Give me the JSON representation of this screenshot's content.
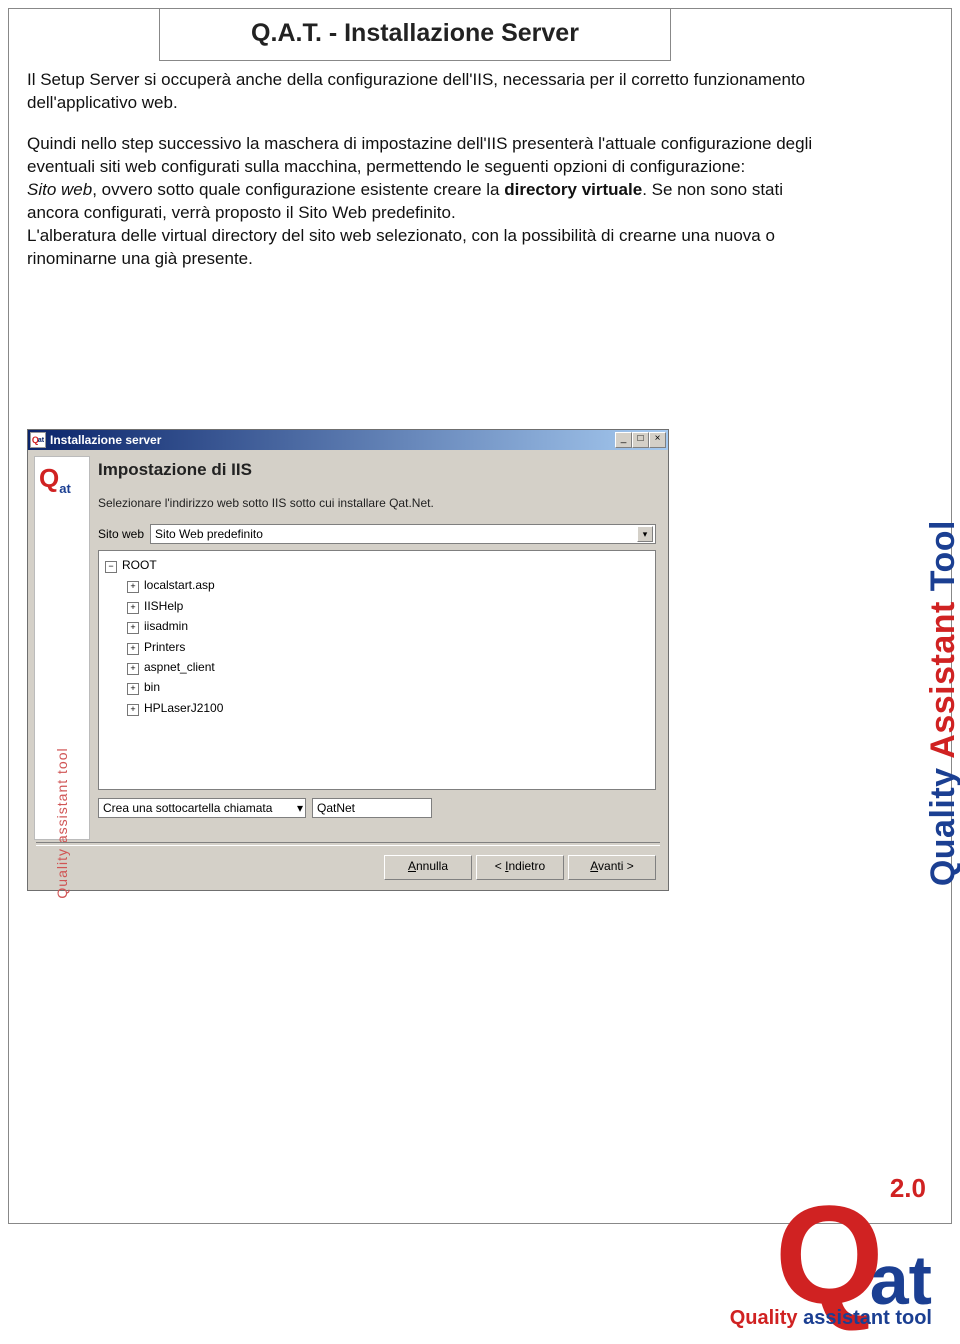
{
  "page": {
    "title": "Q.A.T. - Installazione Server",
    "intro1": "Il Setup Server si occuperà anche della configurazione dell'IIS, necessaria per il corretto funzionamento dell'applicativo web.",
    "intro2a": "Quindi nello step successivo la maschera di impostazine dell'IIS presenterà l'attuale configurazione degli eventuali siti web configurati sulla macchina, permettendo le seguenti opzioni di configurazione:",
    "intro2b_italic": "Sito web",
    "intro2b_rest": ", ovvero sotto quale configurazione esistente creare la ",
    "intro2b_bold": "directory virtuale",
    "intro2b_rest2": ". Se non sono stati ancora configurati, verrà proposto il Sito Web predefinito.",
    "intro3": "L'alberatura delle virtual directory del sito web selezionato, con la possibilità di crearne una nuova o rinominarne una già presente."
  },
  "sidebar": {
    "quality": "Quality ",
    "assistant": "Assistant ",
    "tool": "Tool"
  },
  "shot": {
    "window_title": "Installazione server",
    "win_btns": {
      "min": "_",
      "max": "□",
      "close": "×"
    },
    "wizard_title": "Impostazione di IIS",
    "wizard_desc": "Selezionare l'indirizzo web sotto IIS sotto cui installare Qat.Net.",
    "site_label": "Sito web",
    "site_selected": "Sito Web predefinito",
    "tree": {
      "root": "ROOT",
      "items": [
        "localstart.asp",
        "IISHelp",
        "iisadmin",
        "Printers",
        "aspnet_client",
        "bin",
        "HPLaserJ2100"
      ]
    },
    "subfolder_label": "Crea una sottocartella chiamata",
    "subfolder_value": "QatNet",
    "buttons": {
      "cancel": "Annulla",
      "back": "< Indietro",
      "next": "Avanti >"
    }
  },
  "footer": {
    "version": "2.0",
    "sub_quality": "Quality",
    "sub_rest": " assistant tool"
  }
}
